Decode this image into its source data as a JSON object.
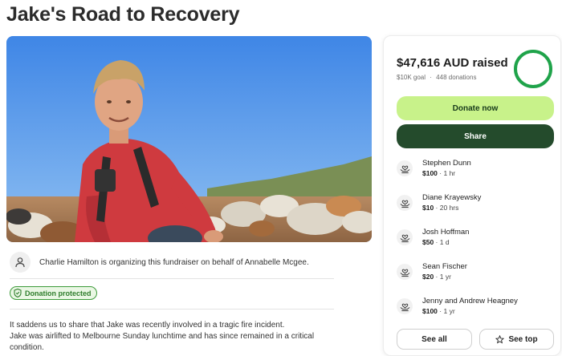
{
  "page": {
    "title": "Jake's Road to Recovery"
  },
  "organizer": {
    "text": "Charlie Hamilton is organizing this fundraiser on behalf of Annabelle Mcgee."
  },
  "badge": {
    "label": "Donation protected"
  },
  "story": {
    "line1": "It saddens us to share that Jake was recently involved in a tragic fire incident.",
    "line2": "Jake was airlifted to Melbourne Sunday lunchtime and has since remained in a critical",
    "line3": "condition."
  },
  "donate_panel": {
    "raised": "$47,616 AUD raised",
    "goal": "$10K goal",
    "separator": "·",
    "donations_count": "448 donations",
    "progress_fraction": 1.0,
    "donate_label": "Donate now",
    "share_label": "Share",
    "see_all_label": "See all",
    "see_top_label": "See top",
    "accent_color": "#1fa34a"
  },
  "donations": [
    {
      "name": "Stephen Dunn",
      "amount": "$100",
      "time": " · 1 hr"
    },
    {
      "name": "Diane Krayewsky",
      "amount": "$10",
      "time": " · 20 hrs"
    },
    {
      "name": "Josh Hoffman",
      "amount": "$50",
      "time": " · 1 d"
    },
    {
      "name": "Sean Fischer",
      "amount": "$20",
      "time": " · 1 yr"
    },
    {
      "name": "Jenny and Andrew Heagney",
      "amount": "$100",
      "time": " · 1 yr"
    }
  ],
  "icons": {
    "organizer": "person-icon",
    "badge": "shield-check-icon",
    "donation": "heart-hands-icon",
    "see_top": "star-icon"
  }
}
